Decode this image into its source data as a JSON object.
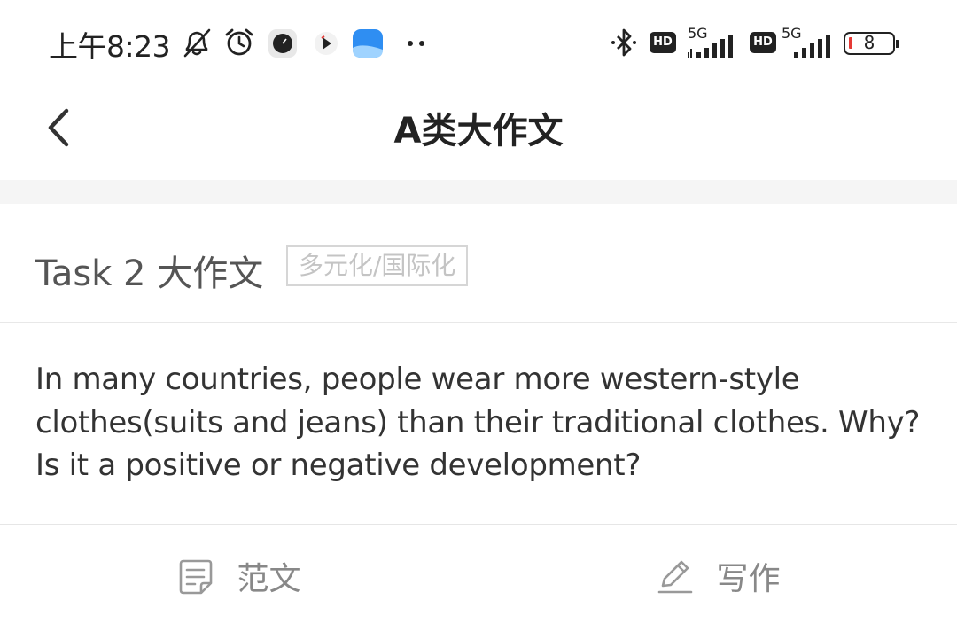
{
  "status_bar": {
    "time": "上午8:23",
    "network_1": "5G",
    "network_2": "5G",
    "hd_1": "HD",
    "hd_2": "HD",
    "battery_level": "8",
    "icons": [
      "mute-bell-icon",
      "alarm-icon",
      "app-clock-icon",
      "app-play-icon",
      "app-blue-icon",
      "more-dots-icon",
      "bluetooth-icon",
      "signal-icon",
      "battery-icon"
    ],
    "battery_low_color": "#e53935"
  },
  "header": {
    "title": "A类大作文",
    "back_icon": "chevron-left-icon"
  },
  "task": {
    "title": "Task 2 大作文",
    "tag": "多元化/国际化"
  },
  "question": {
    "text": "In many countries, people wear more western-style clothes(suits and jeans) than their traditional clothes. Why? Is it a positive or negative development?"
  },
  "actions": {
    "sample_label": "范文",
    "sample_icon": "document-icon",
    "write_label": "写作",
    "write_icon": "pencil-icon"
  }
}
